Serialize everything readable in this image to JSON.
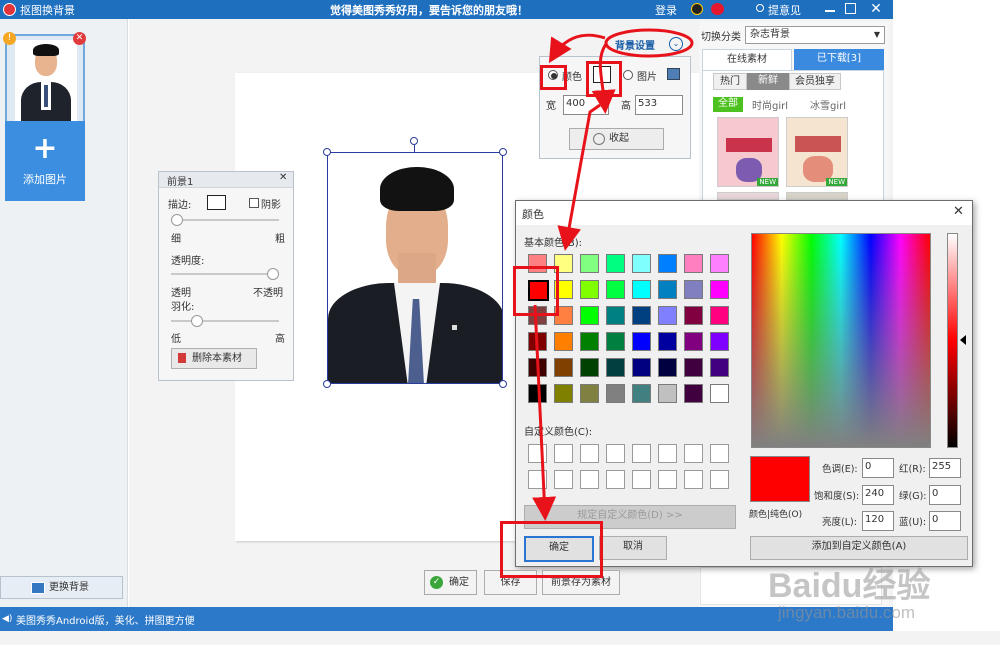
{
  "window": {
    "title": "抠图换背景",
    "slogan": "觉得美图秀秀好用，要告诉您的朋友哦！",
    "login": "登录",
    "feedback": "提意见"
  },
  "sidebar": {
    "add_image": "添加图片",
    "replace_bg": "更换背景"
  },
  "foreground_panel": {
    "title": "前景1",
    "stroke": "描边:",
    "shadow": "阴影",
    "thin": "细",
    "thick": "粗",
    "opacity": "透明度:",
    "transparent": "透明",
    "opaque": "不透明",
    "feather": "羽化:",
    "low": "低",
    "high": "高",
    "delete": "删除本素材"
  },
  "bg_panel": {
    "title": "背景设置",
    "color": "颜色",
    "image": "图片",
    "width_label": "宽",
    "width_value": "400",
    "height_label": "高",
    "height_value": "533",
    "collapse": "收起"
  },
  "right_panel": {
    "switch_category": "切换分类",
    "category": "杂志背景",
    "tab_online": "在线素材",
    "tab_downloaded": "已下载[3]",
    "filters": [
      "热门",
      "新鲜",
      "会员独享"
    ],
    "subfilters": [
      "全部",
      "时尚girl",
      "冰雪girl"
    ],
    "new_badge": "NEW"
  },
  "color_dialog": {
    "title": "颜色",
    "basic": "基本颜色(B):",
    "custom": "自定义颜色(C):",
    "define_custom": "规定自定义颜色(D) >>",
    "ok": "确定",
    "cancel": "取消",
    "color_solid": "颜色|纯色(O)",
    "add_custom": "添加到自定义颜色(A)",
    "hue_label": "色调(E):",
    "hue": "0",
    "sat_label": "饱和度(S):",
    "sat": "240",
    "lum_label": "亮度(L):",
    "lum": "120",
    "red_label": "红(R):",
    "red": "255",
    "green_label": "绿(G):",
    "green": "0",
    "blue_label": "蓝(U):",
    "blue": "0",
    "preview_color": "#ff0000",
    "basic_colors": [
      [
        "#ff8080",
        "#ffff80",
        "#80ff80",
        "#00ff80",
        "#80ffff",
        "#0080ff",
        "#ff80c0",
        "#ff80ff"
      ],
      [
        "#ff0000",
        "#ffff00",
        "#80ff00",
        "#00ff40",
        "#00ffff",
        "#0080c0",
        "#8080c0",
        "#ff00ff"
      ],
      [
        "#804040",
        "#ff8040",
        "#00ff00",
        "#008080",
        "#004080",
        "#8080ff",
        "#800040",
        "#ff0080"
      ],
      [
        "#800000",
        "#ff8000",
        "#008000",
        "#008040",
        "#0000ff",
        "#0000a0",
        "#800080",
        "#8000ff"
      ],
      [
        "#400000",
        "#804000",
        "#004000",
        "#004040",
        "#000080",
        "#000040",
        "#400040",
        "#400080"
      ],
      [
        "#000000",
        "#808000",
        "#808040",
        "#808080",
        "#408080",
        "#c0c0c0",
        "#400040",
        "#ffffff"
      ]
    ]
  },
  "bottom": {
    "confirm": "确定",
    "save": "保存",
    "save_fg": "前景存为素材"
  },
  "status": {
    "text": "美图秀秀Android版，美化、拼图更方便"
  },
  "watermark": {
    "brand": "Baidu经验",
    "url": "jingyan.baidu.com"
  }
}
